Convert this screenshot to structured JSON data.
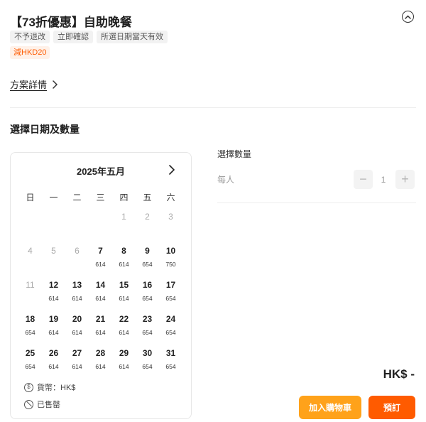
{
  "product": {
    "title": "【73折優惠】自助晚餐",
    "tags": [
      "不予退改",
      "立即確認",
      "所選日期當天有效"
    ],
    "discount": "減HKD20"
  },
  "plan_details_label": "方案詳情",
  "date_section_title": "選擇日期及數量",
  "calendar": {
    "month_label": "2025年五月",
    "weekdays": [
      "日",
      "一",
      "二",
      "三",
      "四",
      "五",
      "六"
    ],
    "weeks": [
      [
        null,
        null,
        null,
        null,
        {
          "d": "1",
          "p": "",
          "disabled": true
        },
        {
          "d": "2",
          "p": "",
          "disabled": true
        },
        {
          "d": "3",
          "p": "",
          "disabled": true
        }
      ],
      [
        {
          "d": "4",
          "p": "",
          "disabled": true
        },
        {
          "d": "5",
          "p": "",
          "disabled": true
        },
        {
          "d": "6",
          "p": "",
          "disabled": true
        },
        {
          "d": "7",
          "p": "614"
        },
        {
          "d": "8",
          "p": "614"
        },
        {
          "d": "9",
          "p": "654"
        },
        {
          "d": "10",
          "p": "750"
        }
      ],
      [
        {
          "d": "11",
          "p": "",
          "disabled": true
        },
        {
          "d": "12",
          "p": "614"
        },
        {
          "d": "13",
          "p": "614"
        },
        {
          "d": "14",
          "p": "614"
        },
        {
          "d": "15",
          "p": "614"
        },
        {
          "d": "16",
          "p": "654"
        },
        {
          "d": "17",
          "p": "654"
        }
      ],
      [
        {
          "d": "18",
          "p": "654"
        },
        {
          "d": "19",
          "p": "614"
        },
        {
          "d": "20",
          "p": "614"
        },
        {
          "d": "21",
          "p": "614"
        },
        {
          "d": "22",
          "p": "614"
        },
        {
          "d": "23",
          "p": "654"
        },
        {
          "d": "24",
          "p": "654"
        }
      ],
      [
        {
          "d": "25",
          "p": "654"
        },
        {
          "d": "26",
          "p": "614"
        },
        {
          "d": "27",
          "p": "614"
        },
        {
          "d": "28",
          "p": "614"
        },
        {
          "d": "29",
          "p": "614"
        },
        {
          "d": "30",
          "p": "654"
        },
        {
          "d": "31",
          "p": "654"
        }
      ]
    ],
    "legend_currency": "貨幣：HK$",
    "legend_sold_out": "已售罄"
  },
  "quantity": {
    "title": "選擇數量",
    "unit_label": "每人",
    "value": "1",
    "minus_symbol": "−",
    "plus_symbol": "+"
  },
  "total_price": "HK$ -",
  "buttons": {
    "add_to_cart": "加入購物車",
    "book": "預訂"
  },
  "icons": [
    "chevron-up-circle-icon",
    "chevron-right-icon",
    "dollar-circle-icon",
    "ban-icon"
  ],
  "colors": {
    "accent_orange": "#ff5b00",
    "cart_orange": "#ffa21a",
    "discount_bg": "#fff1e8"
  }
}
